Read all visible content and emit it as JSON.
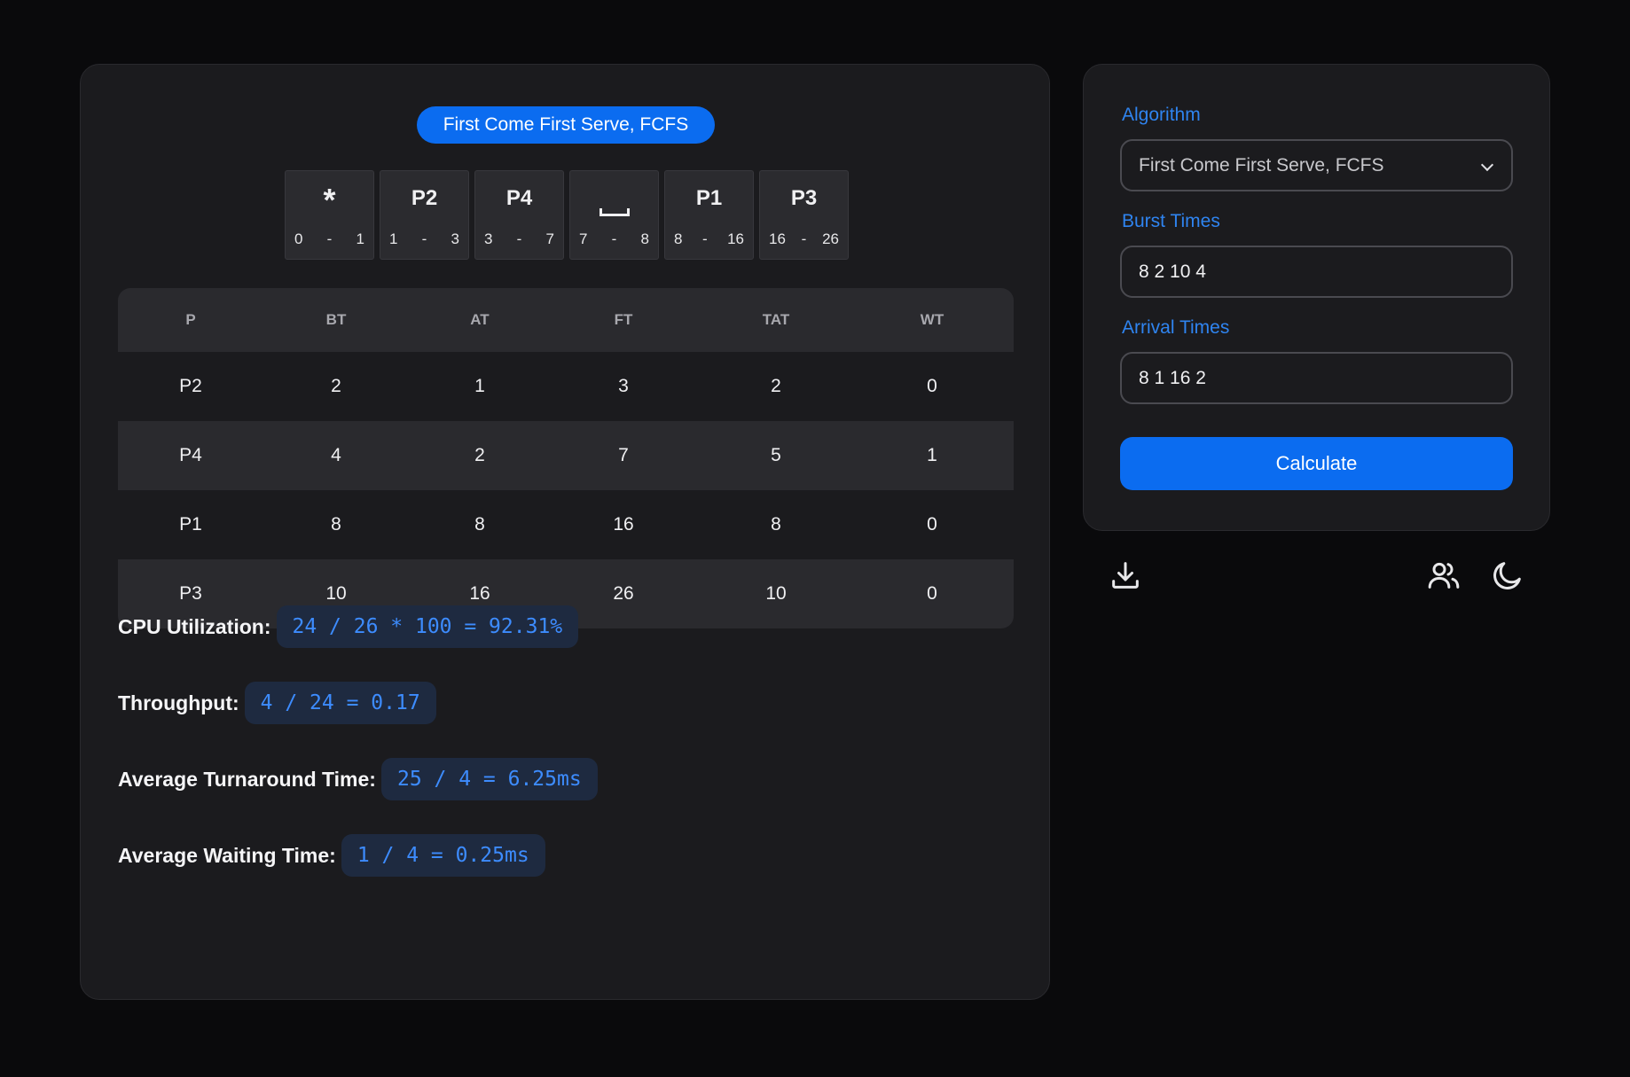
{
  "result": {
    "algorithm_badge": "First Come First Serve, FCFS",
    "gantt": [
      {
        "label": "*",
        "kind": "symbol",
        "start": "0",
        "end": "1"
      },
      {
        "label": "P2",
        "kind": "process",
        "start": "1",
        "end": "3"
      },
      {
        "label": "P4",
        "kind": "process",
        "start": "3",
        "end": "7"
      },
      {
        "label": "",
        "kind": "idle",
        "start": "7",
        "end": "8"
      },
      {
        "label": "P1",
        "kind": "process",
        "start": "8",
        "end": "16"
      },
      {
        "label": "P3",
        "kind": "process",
        "start": "16",
        "end": "26"
      }
    ],
    "range_separator": "-",
    "table": {
      "headers": [
        "P",
        "BT",
        "AT",
        "FT",
        "TAT",
        "WT"
      ],
      "rows": [
        [
          "P2",
          "2",
          "1",
          "3",
          "2",
          "0"
        ],
        [
          "P4",
          "4",
          "2",
          "7",
          "5",
          "1"
        ],
        [
          "P1",
          "8",
          "8",
          "16",
          "8",
          "0"
        ],
        [
          "P3",
          "10",
          "16",
          "26",
          "10",
          "0"
        ]
      ]
    },
    "metrics": {
      "cpu_label": "CPU Utilization:",
      "cpu_value": "24 / 26 * 100 = 92.31%",
      "throughput_label": "Throughput:",
      "throughput_value": "4 / 24 = 0.17",
      "att_label": "Average Turnaround Time:",
      "att_value": "25 / 4 = 6.25ms",
      "awt_label": "Average Waiting Time:",
      "awt_value": "1 / 4 = 0.25ms"
    }
  },
  "form": {
    "algorithm_label": "Algorithm",
    "algorithm_selected": "First Come First Serve, FCFS",
    "burst_label": "Burst Times",
    "burst_value": "8 2 10 4",
    "arrival_label": "Arrival Times",
    "arrival_value": "8 1 16 2",
    "calculate_label": "Calculate"
  },
  "toolbar": {
    "icons": [
      "download-icon",
      "users-icon",
      "moon-icon"
    ]
  },
  "colors": {
    "accent": "#0b6cf0",
    "label_blue": "#2f84f0",
    "code_text": "#3d8cff",
    "background": "#0a0a0c",
    "card": "#1b1b1e"
  }
}
